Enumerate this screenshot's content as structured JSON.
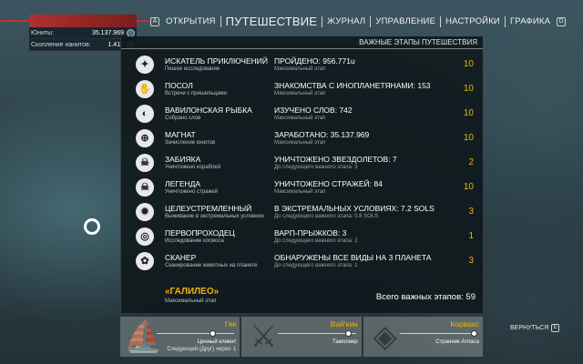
{
  "stats": {
    "units_label": "Юниты:",
    "units_value": "35.137.969",
    "nanites_label": "Скопление нанитов:",
    "nanites_value": "1.417"
  },
  "nav": {
    "left_key": "A",
    "tabs": [
      "ОТКРЫТИЯ",
      "ПУТЕШЕСТВИЕ",
      "ЖУРНАЛ",
      "УПРАВЛЕНИЕ",
      "НАСТРОЙКИ",
      "ГРАФИКА"
    ],
    "active": "ПУТЕШЕСТВИЕ",
    "right_key": "D"
  },
  "panel": {
    "header": "ВАЖНЫЕ ЭТАПЫ ПУТЕШЕСТВИЯ",
    "rows": [
      {
        "icon": "explorer-icon",
        "glyph": "✦",
        "name": "ИСКАТЕЛЬ ПРИКЛЮЧЕНИЙ",
        "sub": "Пешее исследование",
        "progress": "ПРОЙДЕНО: 956.771u",
        "progress_sub": "Максимальный этап",
        "level": "10"
      },
      {
        "icon": "ambassador-icon",
        "glyph": "✋",
        "name": "ПОСОЛ",
        "sub": "Встречи с пришельцами",
        "progress": "ЗНАКОМСТВА С ИНОПЛАНЕТЯНАМИ: 153",
        "progress_sub": "Максимальный этап",
        "level": "10"
      },
      {
        "icon": "fish-icon",
        "glyph": "◐",
        "name": "ВАВИЛОНСКАЯ РЫБКА",
        "sub": "Собрано слов",
        "progress": "ИЗУЧЕНО СЛОВ: 742",
        "progress_sub": "Максимальный этап",
        "level": "10"
      },
      {
        "icon": "magnet-icon",
        "glyph": "⊕",
        "name": "МАГНАТ",
        "sub": "Зачисление юнитов",
        "progress": "ЗАРАБОТАНО: 35.137.969",
        "progress_sub": "Максимальный этап",
        "level": "10"
      },
      {
        "icon": "skull-icon",
        "glyph": "☠",
        "name": "ЗАБИЯКА",
        "sub": "Уничтожено кораблей",
        "progress": "УНИЧТОЖЕНО ЗВЕЗДОЛЕТОВ: 7",
        "progress_sub": "До следующего важного этапа: 3",
        "level": "2"
      },
      {
        "icon": "skull-icon",
        "glyph": "☠",
        "name": "ЛЕГЕНДА",
        "sub": "Уничтожено стражей",
        "progress": "УНИЧТОЖЕНО СТРАЖЕЙ: 84",
        "progress_sub": "Максимальный этап",
        "level": "10"
      },
      {
        "icon": "sun-icon",
        "glyph": "✹",
        "name": "ЦЕЛЕУСТРЕМЛЕННЫЙ",
        "sub": "Выживание в экстремальных условиях",
        "progress": "В ЭКСТРЕМАЛЬНЫХ УСЛОВИЯХ: 7.2 SOLS",
        "progress_sub": "До следующего важного этапа: 0.8 SOLS",
        "level": "3"
      },
      {
        "icon": "warp-icon",
        "glyph": "◎",
        "name": "ПЕРВОПРОХОДЕЦ",
        "sub": "Исследование космоса",
        "progress": "ВАРП-ПРЫЖКОВ: 3",
        "progress_sub": "До следующего важного этапа: 2",
        "level": "1"
      },
      {
        "icon": "paw-icon",
        "glyph": "✿",
        "name": "СКАНЕР",
        "sub": "Сканирование животных на планете",
        "progress": "ОБНАРУЖЕНЫ ВСЕ ВИДЫ НА 3 ПЛАНЕТА",
        "progress_sub": "До следующего важного этапа: 1",
        "level": "3"
      }
    ],
    "rank_title": "«ГАЛИЛЕО»",
    "rank_sub": "Максимальный этап",
    "total": "Всего важных этапов: 59"
  },
  "standing": [
    {
      "icon": "gek-emblem-icon",
      "glyph": "⛵",
      "name": "Гек",
      "rank": "Ценный клиент",
      "next": "Следующий (Друг) через: 1",
      "dot_pos": 0.55
    },
    {
      "icon": "vykeen-emblem-icon",
      "glyph": "⚔",
      "name": "Вай'кин",
      "rank": "Тамплиер",
      "next": "",
      "dot_pos": 0.8
    },
    {
      "icon": "korvax-emblem-icon",
      "glyph": "◈",
      "name": "Корвакс",
      "rank": "Странник Атласа",
      "next": "",
      "dot_pos": 0.95
    }
  ],
  "back": {
    "label": "ВЕРНУТЬСЯ",
    "key": "E"
  }
}
